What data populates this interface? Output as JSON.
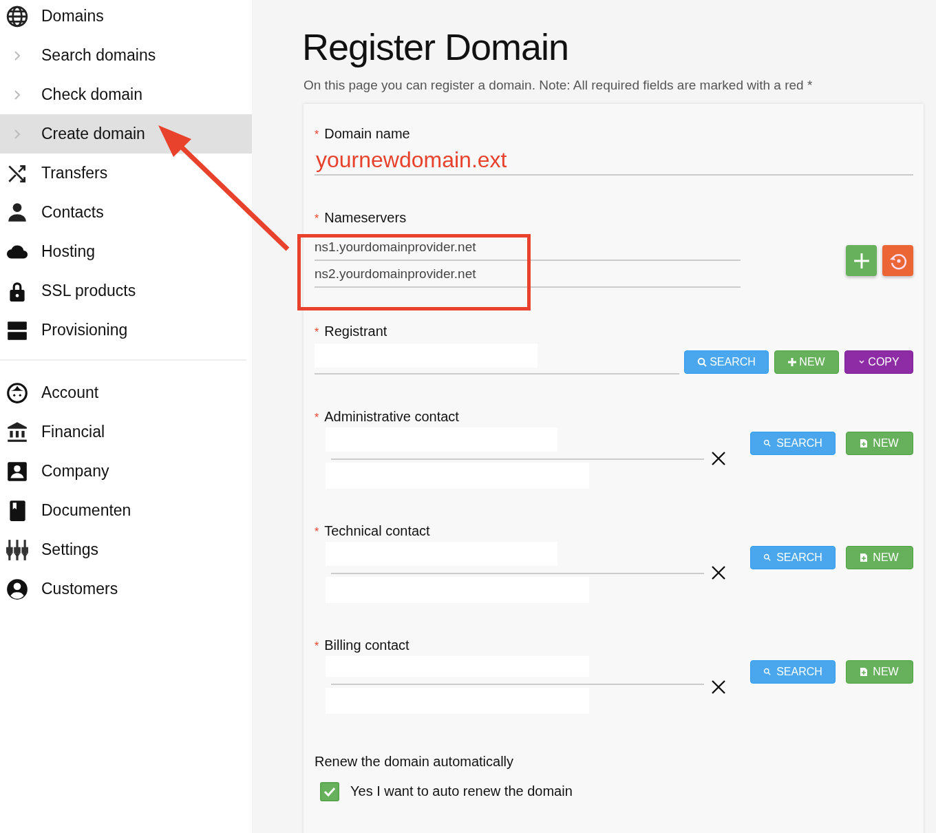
{
  "sidebar": {
    "groups": [
      {
        "items": [
          {
            "label": "Domains",
            "kind": "section",
            "selected": false
          },
          {
            "label": "Search domains",
            "kind": "subitem",
            "selected": false
          },
          {
            "label": "Check domain",
            "kind": "subitem",
            "selected": false
          },
          {
            "label": "Create domain",
            "kind": "subitem",
            "selected": true
          },
          {
            "label": "Transfers",
            "kind": "section",
            "selected": false
          },
          {
            "label": "Contacts",
            "kind": "section",
            "selected": false
          },
          {
            "label": "Hosting",
            "kind": "section",
            "selected": false
          },
          {
            "label": "SSL products",
            "kind": "section",
            "selected": false
          },
          {
            "label": "Provisioning",
            "kind": "section",
            "selected": false
          }
        ]
      },
      {
        "items": [
          {
            "label": "Account",
            "kind": "section",
            "selected": false
          },
          {
            "label": "Financial",
            "kind": "section",
            "selected": false
          },
          {
            "label": "Company",
            "kind": "section",
            "selected": false
          },
          {
            "label": "Documenten",
            "kind": "section",
            "selected": false
          },
          {
            "label": "Settings",
            "kind": "section",
            "selected": false
          },
          {
            "label": "Customers",
            "kind": "section",
            "selected": false
          }
        ]
      }
    ]
  },
  "page": {
    "title": "Register Domain",
    "intro": "On this page you can register a domain. Note: All required fields are marked with a red *"
  },
  "form": {
    "domain_name": {
      "required_mark": "*",
      "label": "Domain name",
      "value": "yournewdomain.ext"
    },
    "nameservers": {
      "required_mark": "*",
      "label": "Nameservers",
      "values": [
        "ns1.yourdomainprovider.net",
        "ns2.yourdomainprovider.net"
      ]
    },
    "registrant": {
      "required_mark": "*",
      "label": "Registrant",
      "buttons": [
        {
          "kind": "search",
          "label": "SEARCH"
        },
        {
          "kind": "new",
          "label": "NEW"
        },
        {
          "kind": "copy",
          "label": "COPY"
        }
      ]
    },
    "contacts": [
      {
        "required_mark": "*",
        "label": "Administrative contact",
        "buttons": [
          {
            "kind": "search",
            "label": "SEARCH"
          },
          {
            "kind": "new",
            "label": "NEW"
          }
        ]
      },
      {
        "required_mark": "*",
        "label": "Technical contact",
        "buttons": [
          {
            "kind": "search",
            "label": "SEARCH"
          },
          {
            "kind": "new",
            "label": "NEW"
          }
        ]
      },
      {
        "required_mark": "*",
        "label": "Billing contact",
        "buttons": [
          {
            "kind": "search",
            "label": "SEARCH"
          },
          {
            "kind": "new",
            "label": "NEW"
          }
        ]
      }
    ],
    "auto_renew": {
      "heading": "Renew the domain automatically",
      "label": "Yes I want to auto renew the domain",
      "checked": true
    }
  }
}
